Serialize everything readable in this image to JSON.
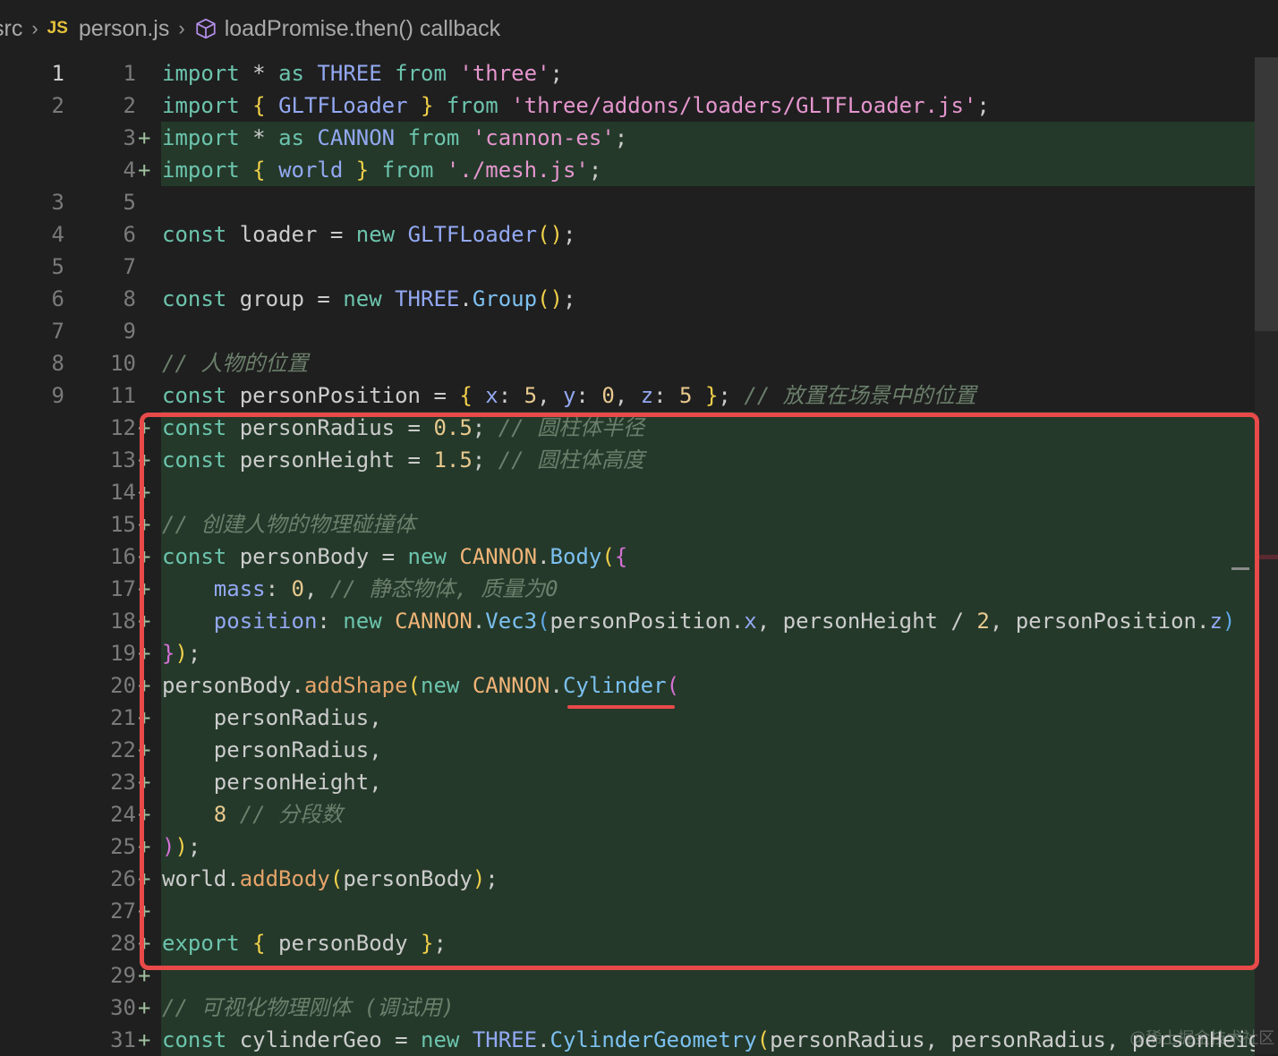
{
  "breadcrumb": {
    "folder": "src",
    "file_badge": "JS",
    "file": "person.js",
    "symbol_icon": "cube-icon",
    "symbol": "loadPromise.then() callback"
  },
  "editor": {
    "lines": [
      {
        "old": "1",
        "new": "1",
        "mark": "",
        "current": true,
        "html": "<span class='kw'>import</span> * <span class='kw'>as</span> <span class='cls'>THREE</span> <span class='kw'>from</span> <span class='str'>'three'</span>;"
      },
      {
        "old": "2",
        "new": "2",
        "mark": "",
        "html": "<span class='kw'>import</span> <span class='br'>{</span> <span class='cls'>GLTFLoader</span> <span class='br'>}</span> <span class='kw'>from</span> <span class='str'>'three/addons/loaders/GLTFLoader.js'</span>;"
      },
      {
        "old": "",
        "new": "3",
        "mark": "+",
        "added": true,
        "html": "<span class='kw'>import</span> * <span class='kw'>as</span> <span class='cls'>CANNON</span> <span class='kw'>from</span> <span class='str'>'cannon-es'</span>;"
      },
      {
        "old": "",
        "new": "4",
        "mark": "+",
        "added": true,
        "html": "<span class='kw'>import</span> <span class='br'>{</span> <span class='cls'>world</span> <span class='br'>}</span> <span class='kw'>from</span> <span class='str'>'./mesh.js'</span>;"
      },
      {
        "old": "3",
        "new": "5",
        "mark": "",
        "html": ""
      },
      {
        "old": "4",
        "new": "6",
        "mark": "",
        "html": "<span class='kw'>const</span> loader = <span class='kw'>new</span> <span class='cls'>GLTFLoader</span><span class='br'>()</span>;"
      },
      {
        "old": "5",
        "new": "7",
        "mark": "",
        "html": ""
      },
      {
        "old": "6",
        "new": "8",
        "mark": "",
        "html": "<span class='kw'>const</span> group = <span class='kw'>new</span> <span class='cls'>THREE</span>.<span class='method'>Group</span><span class='br'>()</span>;"
      },
      {
        "old": "7",
        "new": "9",
        "mark": "",
        "html": ""
      },
      {
        "old": "8",
        "new": "10",
        "mark": "",
        "html": "<span class='com'>// 人物的位置</span>"
      },
      {
        "old": "9",
        "new": "11",
        "mark": "",
        "html": "<span class='kw'>const</span> personPosition = <span class='br'>{</span> <span class='prop'>x</span>: <span class='num'>5</span>, <span class='prop'>y</span>: <span class='num'>0</span>, <span class='prop'>z</span>: <span class='num'>5</span> <span class='br'>}</span>; <span class='com'>// 放置在场景中的位置</span>"
      },
      {
        "old": "",
        "new": "12",
        "mark": "+",
        "added": true,
        "html": "<span class='kw'>const</span> personRadius = <span class='num'>0.5</span>; <span class='com'>// 圆柱体半径</span>"
      },
      {
        "old": "",
        "new": "13",
        "mark": "+",
        "added": true,
        "html": "<span class='kw'>const</span> personHeight = <span class='num'>1.5</span>; <span class='com'>// 圆柱体高度</span>"
      },
      {
        "old": "",
        "new": "14",
        "mark": "+",
        "added": true,
        "html": ""
      },
      {
        "old": "",
        "new": "15",
        "mark": "+",
        "added": true,
        "html": "<span class='com'>// 创建人物的物理碰撞体</span>"
      },
      {
        "old": "",
        "new": "16",
        "mark": "+",
        "added": true,
        "html": "<span class='kw'>const</span> personBody = <span class='kw'>new</span> <span class='cannon'>CANNON</span>.<span class='method'>Body</span><span class='br'>(</span><span class='br2'>{</span>"
      },
      {
        "old": "",
        "new": "17",
        "mark": "+",
        "added": true,
        "html": "    <span class='prop'>mass</span>: <span class='num'>0</span>, <span class='com'>// 静态物体, 质量为0</span>"
      },
      {
        "old": "",
        "new": "18",
        "mark": "+",
        "added": true,
        "html": "    <span class='prop'>position</span>: <span class='kw'>new</span> <span class='cannon'>CANNON</span>.<span class='method'>Vec3</span><span class='br3'>(</span>personPosition.<span class='prop'>x</span>, personHeight / <span class='num'>2</span>, personPosition.<span class='prop'>z</span><span class='br3'>)</span>"
      },
      {
        "old": "",
        "new": "19",
        "mark": "+",
        "added": true,
        "html": "<span class='br2'>}</span><span class='br'>)</span>;"
      },
      {
        "old": "",
        "new": "20",
        "mark": "+",
        "added": true,
        "html": "personBody.<span class='fn'>addShape</span><span class='br'>(</span><span class='kw'>new</span> <span class='cannon'>CANNON</span>.<span class='method'>Cylinder</span><span class='br2'>(</span>"
      },
      {
        "old": "",
        "new": "21",
        "mark": "+",
        "added": true,
        "html": "    personRadius,"
      },
      {
        "old": "",
        "new": "22",
        "mark": "+",
        "added": true,
        "html": "    personRadius,"
      },
      {
        "old": "",
        "new": "23",
        "mark": "+",
        "added": true,
        "html": "    personHeight,"
      },
      {
        "old": "",
        "new": "24",
        "mark": "+",
        "added": true,
        "html": "    <span class='num'>8</span> <span class='com'>// 分段数</span>"
      },
      {
        "old": "",
        "new": "25",
        "mark": "+",
        "added": true,
        "html": "<span class='br2'>)</span><span class='br'>)</span>;"
      },
      {
        "old": "",
        "new": "26",
        "mark": "+",
        "added": true,
        "html": "world.<span class='fn'>addBody</span><span class='br'>(</span>personBody<span class='br'>)</span>;"
      },
      {
        "old": "",
        "new": "27",
        "mark": "+",
        "added": true,
        "html": ""
      },
      {
        "old": "",
        "new": "28",
        "mark": "+",
        "added": true,
        "html": "<span class='kw'>export</span> <span class='br'>{</span> personBody <span class='br'>}</span>;"
      },
      {
        "old": "",
        "new": "29",
        "mark": "+",
        "added": true,
        "html": ""
      },
      {
        "old": "",
        "new": "30",
        "mark": "+",
        "added": true,
        "html": "<span class='com'>// 可视化物理刚体 (调试用)</span>"
      },
      {
        "old": "",
        "new": "31",
        "mark": "+",
        "added": true,
        "html": "<span class='kw'>const</span> cylinderGeo = <span class='kw'>new</span> <span class='cls'>THREE</span>.<span class='method'>CylinderGeometry</span><span class='br'>(</span>personRadius, personRadius, personHeig"
      }
    ]
  },
  "watermark": "@稀土掘金技术社区",
  "colors": {
    "background": "#1f1f1f",
    "added_line": "#24392a",
    "highlight_box": "#e84a4a"
  }
}
